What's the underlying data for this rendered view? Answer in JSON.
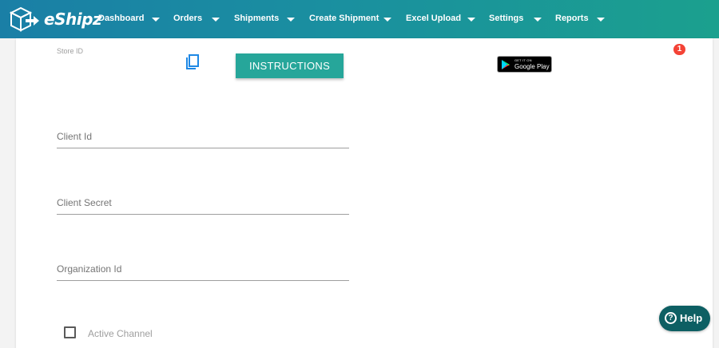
{
  "brand": {
    "name": "eShipz",
    "accent": "#26a69a",
    "nav_gradient": [
      "#1a7fa6",
      "#1ba08e"
    ]
  },
  "nav": {
    "items": [
      {
        "label": "Dashboard"
      },
      {
        "label": "Orders"
      },
      {
        "label": "Shipments"
      },
      {
        "label": "Create Shipment"
      },
      {
        "label": "Excel Upload"
      },
      {
        "label": "Settings"
      },
      {
        "label": "Reports"
      }
    ]
  },
  "store": {
    "label": "Store ID"
  },
  "buttons": {
    "instructions": "INSTRUCTIONS",
    "help": "Help",
    "help_icon_glyph": "?"
  },
  "google_play": {
    "small": "GET IT ON",
    "big": "Google Play"
  },
  "notification": {
    "count": "1"
  },
  "form": {
    "client_id": {
      "placeholder": "Client Id",
      "value": ""
    },
    "client_secret": {
      "placeholder": "Client Secret",
      "value": ""
    },
    "organization_id": {
      "placeholder": "Organization Id",
      "value": ""
    },
    "active_channel": {
      "label": "Active Channel",
      "checked": false
    }
  },
  "icons": [
    "logo-box-icon",
    "chevron-down-icon",
    "copy-icon",
    "google-play-icon",
    "help-icon"
  ]
}
